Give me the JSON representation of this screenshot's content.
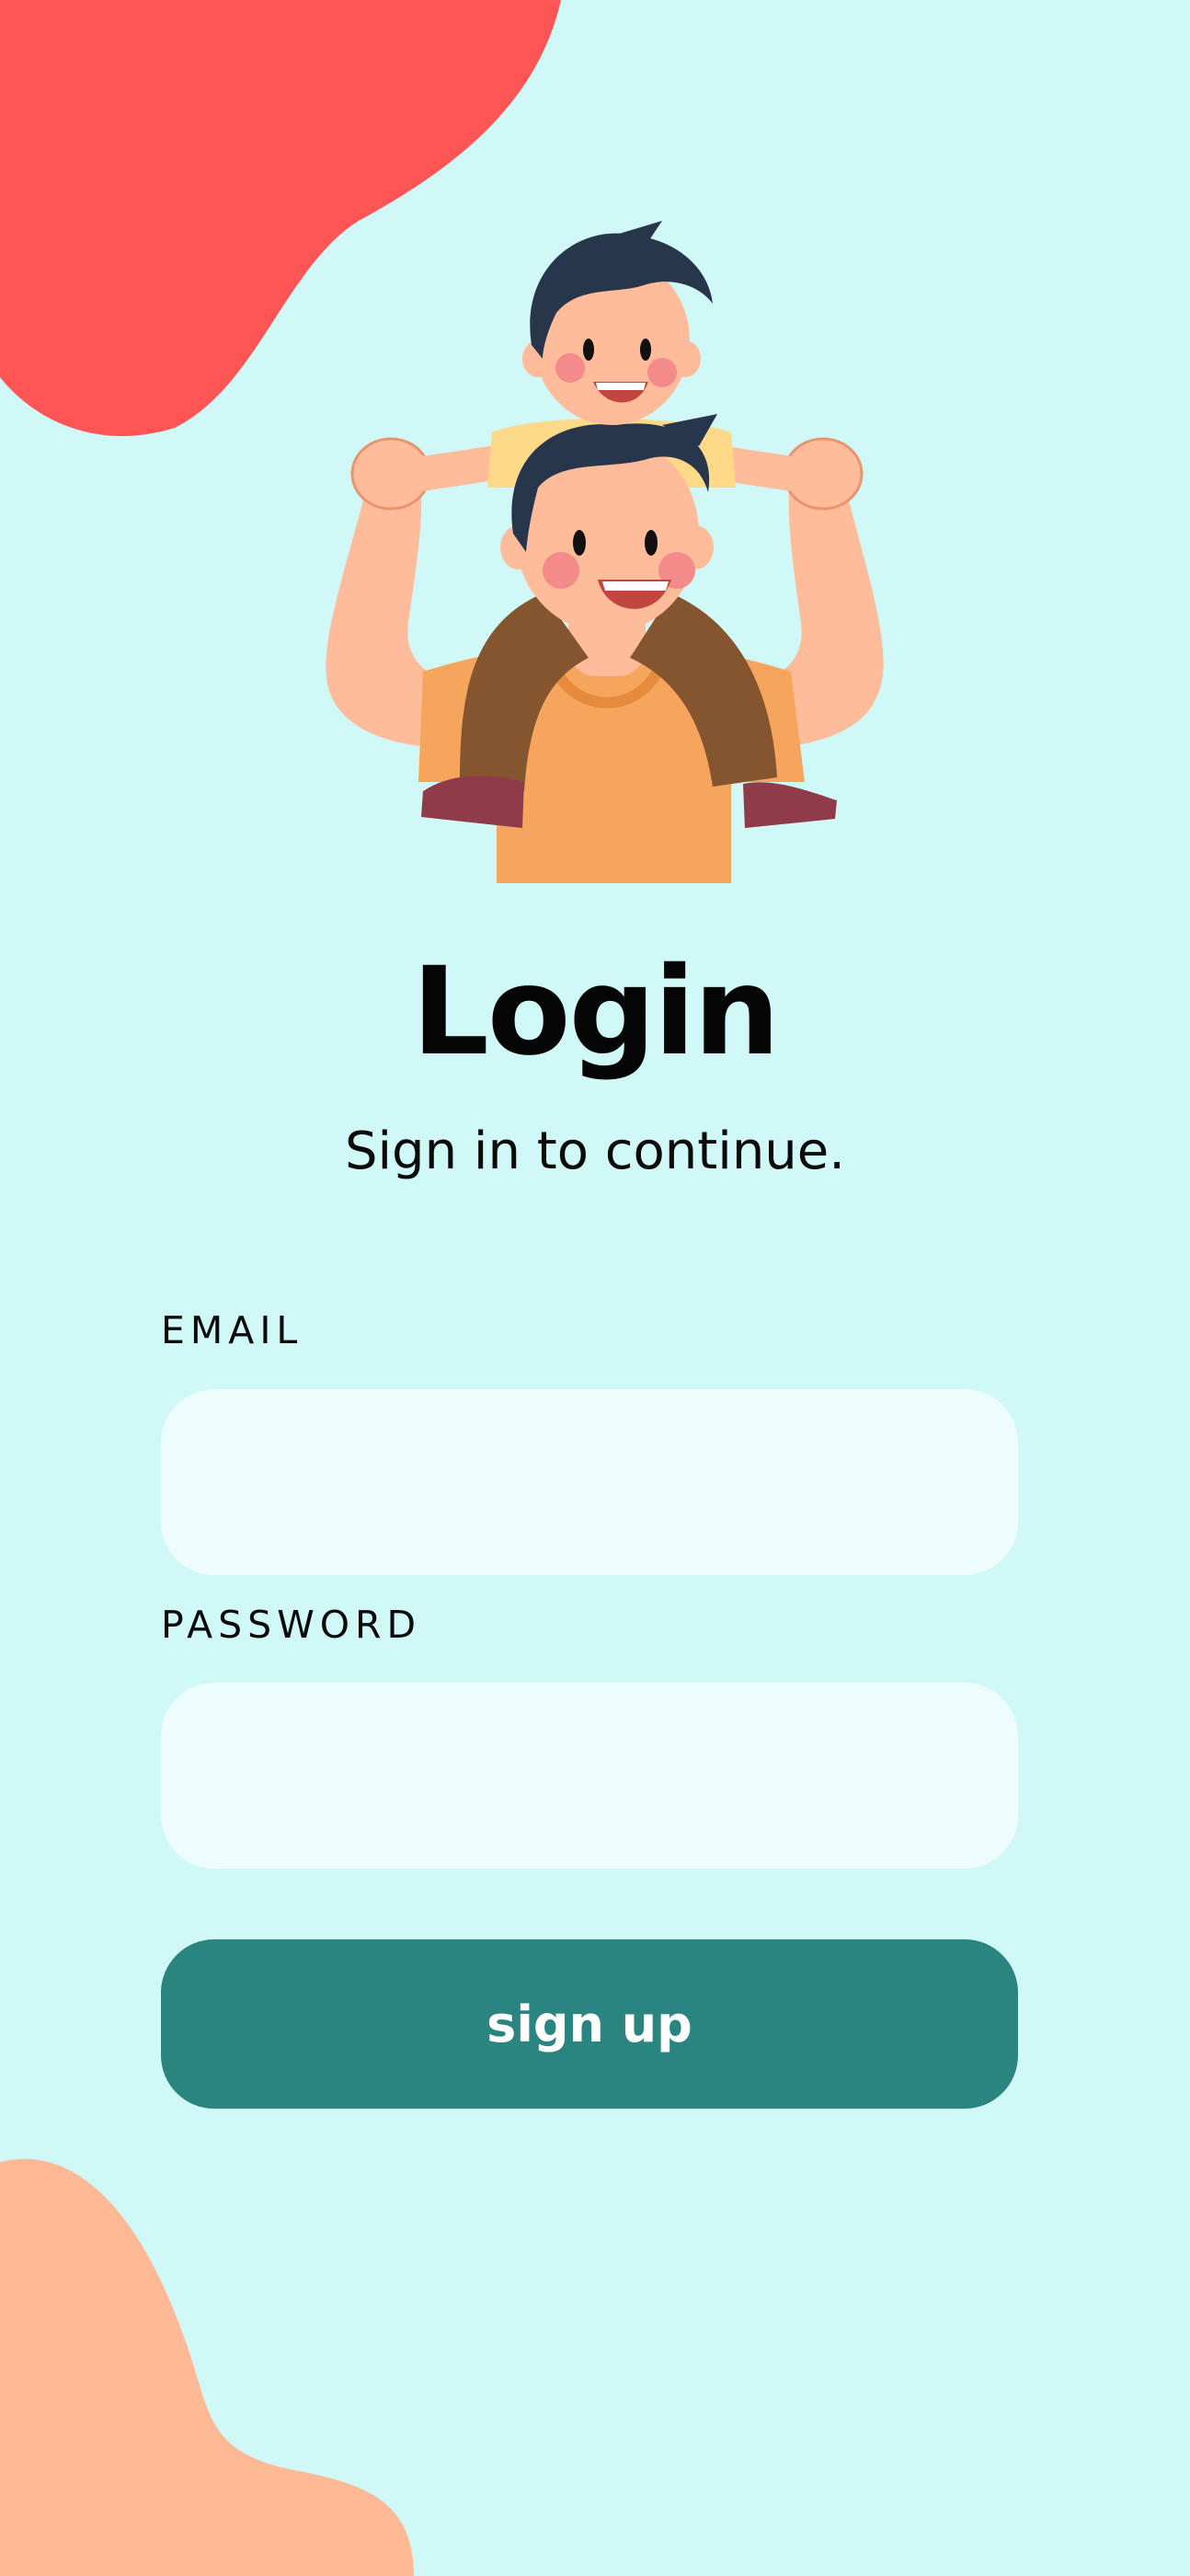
{
  "login": {
    "title": "Login",
    "subtitle": "Sign in to continue.",
    "email_label": "EMAIL",
    "email_value": "",
    "password_label": "PASSWORD",
    "password_value": "",
    "submit_label": "sign up"
  },
  "colors": {
    "background": "#d0f8f7",
    "blob_top": "#ff5555",
    "blob_bottom": "#ffb995",
    "input_fill": "#edfdfd",
    "button": "#2a8480",
    "button_text": "#ffffff"
  },
  "illustration": "father-carrying-son-on-shoulders-illustration"
}
